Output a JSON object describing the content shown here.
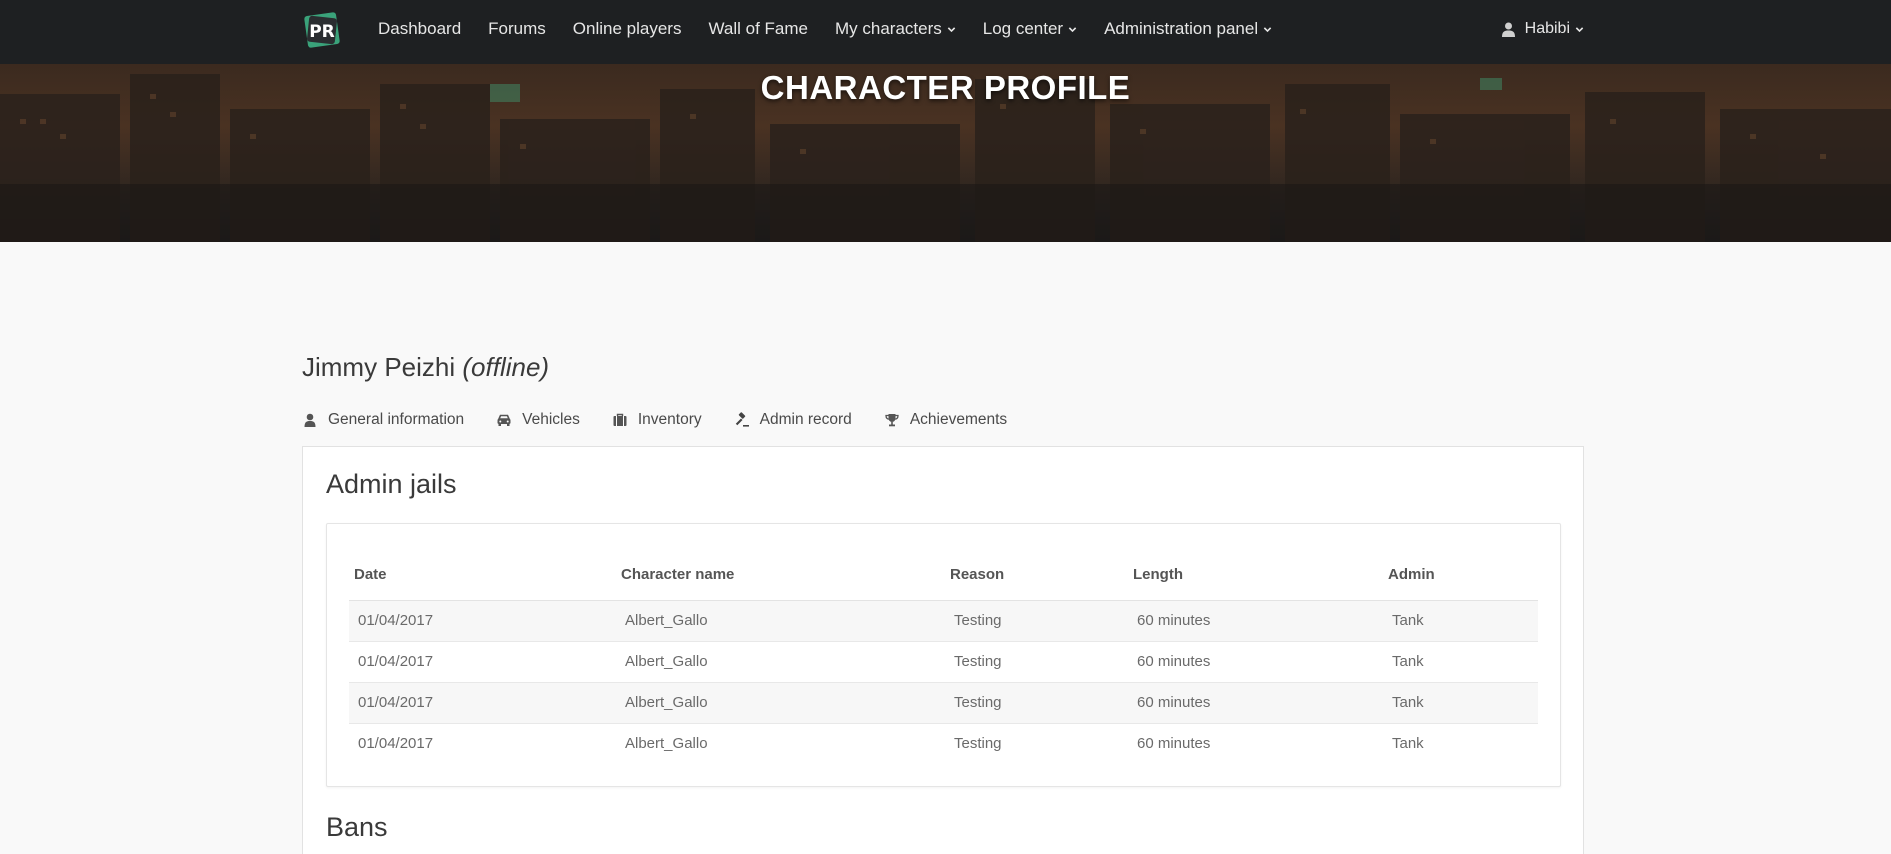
{
  "nav": {
    "logo_text": "PR",
    "links": [
      {
        "label": "Dashboard",
        "dropdown": false
      },
      {
        "label": "Forums",
        "dropdown": false
      },
      {
        "label": "Online players",
        "dropdown": false
      },
      {
        "label": "Wall of Fame",
        "dropdown": false
      },
      {
        "label": "My characters",
        "dropdown": true
      },
      {
        "label": "Log center",
        "dropdown": true
      },
      {
        "label": "Administration panel",
        "dropdown": true
      }
    ],
    "user": "Habibi"
  },
  "hero": {
    "title": "CHARACTER PROFILE"
  },
  "character": {
    "name": "Jimmy Peizhi",
    "status": "(offline)"
  },
  "tabs": [
    {
      "label": "General information",
      "icon": "user-icon"
    },
    {
      "label": "Vehicles",
      "icon": "car-icon"
    },
    {
      "label": "Inventory",
      "icon": "briefcase-icon"
    },
    {
      "label": "Admin record",
      "icon": "gavel-icon",
      "active": true
    },
    {
      "label": "Achievements",
      "icon": "trophy-icon"
    }
  ],
  "admin_jails": {
    "title": "Admin jails",
    "columns": [
      "Date",
      "Character name",
      "Reason",
      "Length",
      "Admin"
    ],
    "rows": [
      [
        "01/04/2017",
        "Albert_Gallo",
        "Testing",
        "60 minutes",
        "Tank"
      ],
      [
        "01/04/2017",
        "Albert_Gallo",
        "Testing",
        "60 minutes",
        "Tank"
      ],
      [
        "01/04/2017",
        "Albert_Gallo",
        "Testing",
        "60 minutes",
        "Tank"
      ],
      [
        "01/04/2017",
        "Albert_Gallo",
        "Testing",
        "60 minutes",
        "Tank"
      ]
    ]
  },
  "bans": {
    "title": "Bans"
  },
  "colors": {
    "navbar_bg": "#1e2022",
    "active_tab_underline": "#2f6fd6",
    "logo_green": "#3aa27a"
  }
}
